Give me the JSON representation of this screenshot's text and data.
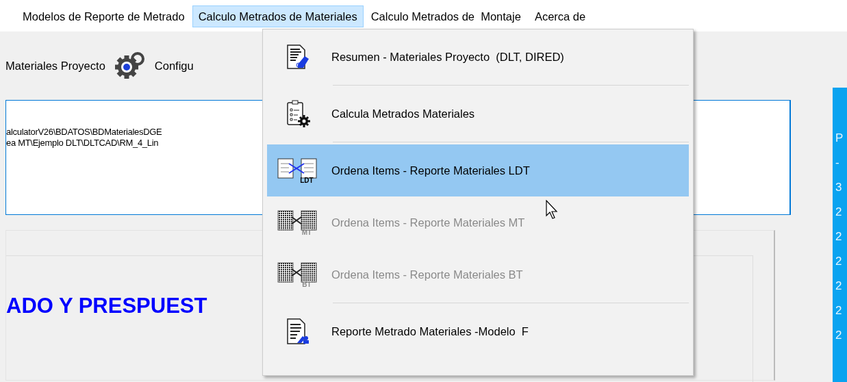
{
  "menubar": [
    {
      "label": "Modelos de Reporte de Metrado",
      "selected": false
    },
    {
      "label": "Calculo Metrados de Materiales",
      "selected": true
    },
    {
      "label": "Calculo Metrados de  Montaje",
      "selected": false
    },
    {
      "label": "Acerca de",
      "selected": false
    }
  ],
  "toolbar": [
    {
      "kind": "text",
      "label": "Materiales Proyecto"
    },
    {
      "kind": "gear",
      "label": "Configu"
    }
  ],
  "path_box": {
    "lines": [
      "alculatorV26\\BDATOS\\BDMaterialesDGE",
      "ea MT\\Ejemplo DLT\\DLTCAD\\RM_4_Lin"
    ]
  },
  "panel": {
    "heading": "ADO Y PRESPUEST"
  },
  "side_column": [
    "P",
    "-",
    "3",
    "2",
    "2",
    "2",
    "2",
    "2",
    "2"
  ],
  "dropdown": [
    {
      "kind": "summary",
      "label": "Resumen - Materiales Proyecto  (DLT, DIRED)",
      "selected": false,
      "disabled": false,
      "separator_after": true
    },
    {
      "kind": "calculate",
      "label": "Calcula Metrados Materiales",
      "selected": false,
      "disabled": false,
      "separator_after": true
    },
    {
      "kind": "sort",
      "label": "Ordena Items - Reporte Materiales LDT",
      "icon_caption": "LDT",
      "selected": true,
      "disabled": false,
      "separator_after": false
    },
    {
      "kind": "sort",
      "label": "Ordena Items - Reporte Materiales MT",
      "icon_caption": "MT",
      "selected": false,
      "disabled": true,
      "separator_after": false
    },
    {
      "kind": "sort",
      "label": "Ordena Items - Reporte Materiales BT",
      "icon_caption": "BT",
      "selected": false,
      "disabled": true,
      "separator_after": true
    },
    {
      "kind": "report",
      "label": "Reporte Metrado Materiales -Modelo  F",
      "selected": false,
      "disabled": false,
      "separator_after": false
    }
  ]
}
